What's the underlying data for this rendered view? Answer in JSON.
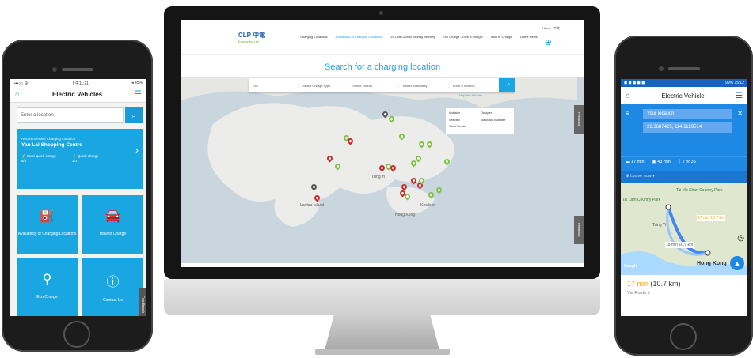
{
  "left_phone": {
    "status": {
      "carrier": "•••○○ 令",
      "time": "上午11:21",
      "battery": "◂ 45%"
    },
    "title": "Electric Vehicles",
    "search_placeholder": "Enter a location",
    "recommended": {
      "caption": "Recommended Charging Location",
      "name": "Yau Lai Shopping Centre",
      "semi_quick": "Semi-quick charge",
      "semi_quick_count": "8/1",
      "quick": "Quick charge",
      "quick_count": "1/1"
    },
    "tiles": [
      "Availability of Charging Locations",
      "How to Charge",
      "Eco Charge",
      "Contact Us"
    ],
    "feedback": "Feedback"
  },
  "monitor": {
    "logo": "CLP 中電",
    "logo_tagline": "Energy for Life",
    "nav": [
      "Charging Locations",
      "Availability of Charging Locations",
      "Go Low Carbon Driving Journey",
      "Eco Charge - Give a charge!",
      "How to Charge",
      "Latest News"
    ],
    "lang": {
      "home": "Home",
      "chinese": "中文"
    },
    "heading": "Search for a charging location",
    "filters": [
      "Exit",
      "Select Charge Type",
      "Select District",
      "Select Availability",
      "Enter a location"
    ],
    "map_view": "Map view  List view",
    "legend": [
      "Available",
      "Occupied",
      "Selected",
      "Status Not Available",
      "Out of Service"
    ],
    "map_labels": [
      "Tsing Yi",
      "Hong Kong",
      "Lantau Island",
      "Kowloon"
    ],
    "feedback": "Feedback"
  },
  "right_phone": {
    "status": {
      "time": "15:12",
      "battery": "99%"
    },
    "title": "Electric Vehicle",
    "from": "Your location",
    "to": "22.3687425, 114.1129514",
    "modes": [
      "17 min",
      "43 min",
      "2 hr 35"
    ],
    "leave": "Leave now",
    "map_labels": [
      "Tai Lam Country Park",
      "Tai Mo Shan Country Park",
      "Tsing Yi",
      "Hong Kong",
      "17 min 10.7 km",
      "18 min 10.9 km",
      "Google"
    ],
    "summary_time": "17 min",
    "summary_dist": "(10.7 km)",
    "via": "Via Route 5"
  }
}
